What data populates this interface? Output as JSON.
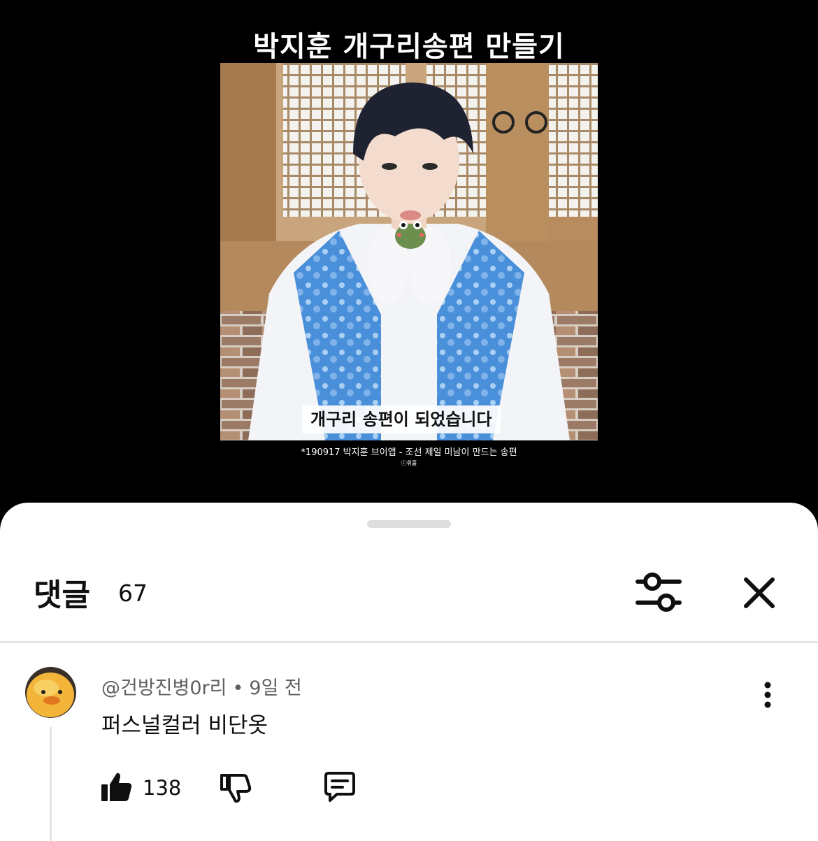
{
  "video": {
    "title": "박지훈 개구리송편 만들기",
    "subtitle": "개구리 송편이 되었습니다",
    "caption": "*190917 박지훈 브이앱 - 조선 제일 미남이 만드는 송편",
    "credit": "ⓒ휘휼"
  },
  "comments_panel": {
    "title": "댓글",
    "count": "67",
    "filter_icon": "sliders-icon",
    "close_icon": "close-icon"
  },
  "comment": {
    "author": "@건방진병0r리",
    "separator": "•",
    "time": "9일 전",
    "text": "퍼스널컬러 비단옷",
    "like_count": "138",
    "icons": [
      "thumbs-up-icon",
      "thumbs-down-icon",
      "reply-icon",
      "more-vertical-icon"
    ]
  },
  "colors": {
    "background_top": "#000000",
    "sheet": "#ffffff",
    "text_primary": "#0f0f0f",
    "text_secondary": "#606060",
    "divider": "#e5e5e5"
  }
}
